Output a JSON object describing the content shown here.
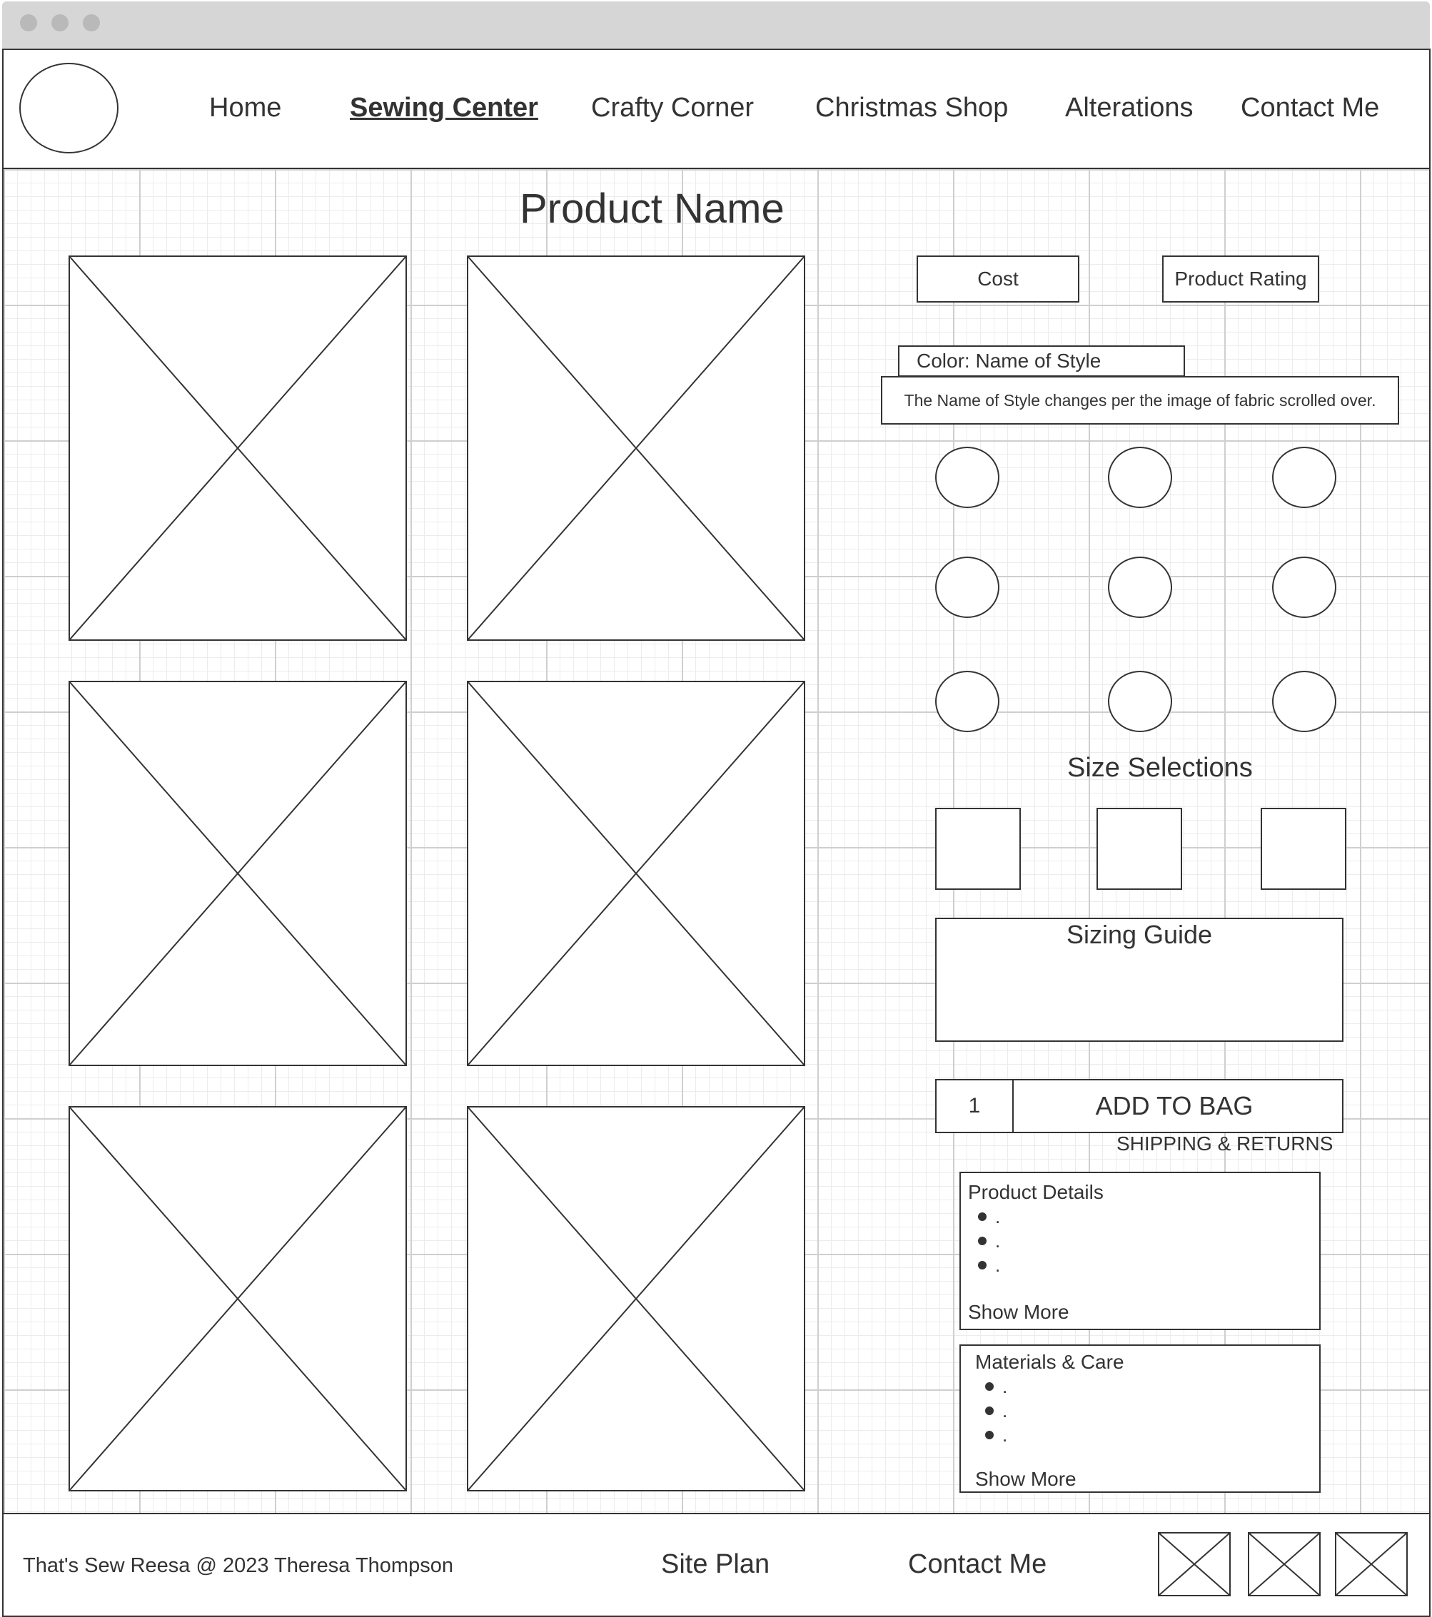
{
  "nav": {
    "items": [
      "Home",
      "Sewing Center",
      "Crafty Corner",
      "Christmas Shop",
      "Alterations",
      "Contact Me"
    ]
  },
  "product": {
    "name": "Product Name",
    "cost_label": "Cost",
    "rating_label": "Product Rating",
    "color_label": "Color: Name of Style",
    "color_note": "The Name of Style changes per the image of fabric scrolled over.",
    "size_heading": "Size Selections",
    "sizing_guide": "Sizing Guide",
    "quantity": "1",
    "add_to_bag": "ADD TO BAG",
    "shipping_returns": "SHIPPING & RETURNS"
  },
  "details": {
    "title": "Product Details",
    "items": [
      ".",
      ".",
      "."
    ],
    "show_more": "Show More"
  },
  "materials": {
    "title": "Materials & Care",
    "items": [
      ".",
      ".",
      "."
    ],
    "show_more": "Show More"
  },
  "footer": {
    "copyright": "That's Sew Reesa @ 2023 Theresa Thompson",
    "site_plan": "Site Plan",
    "contact": "Contact Me"
  }
}
